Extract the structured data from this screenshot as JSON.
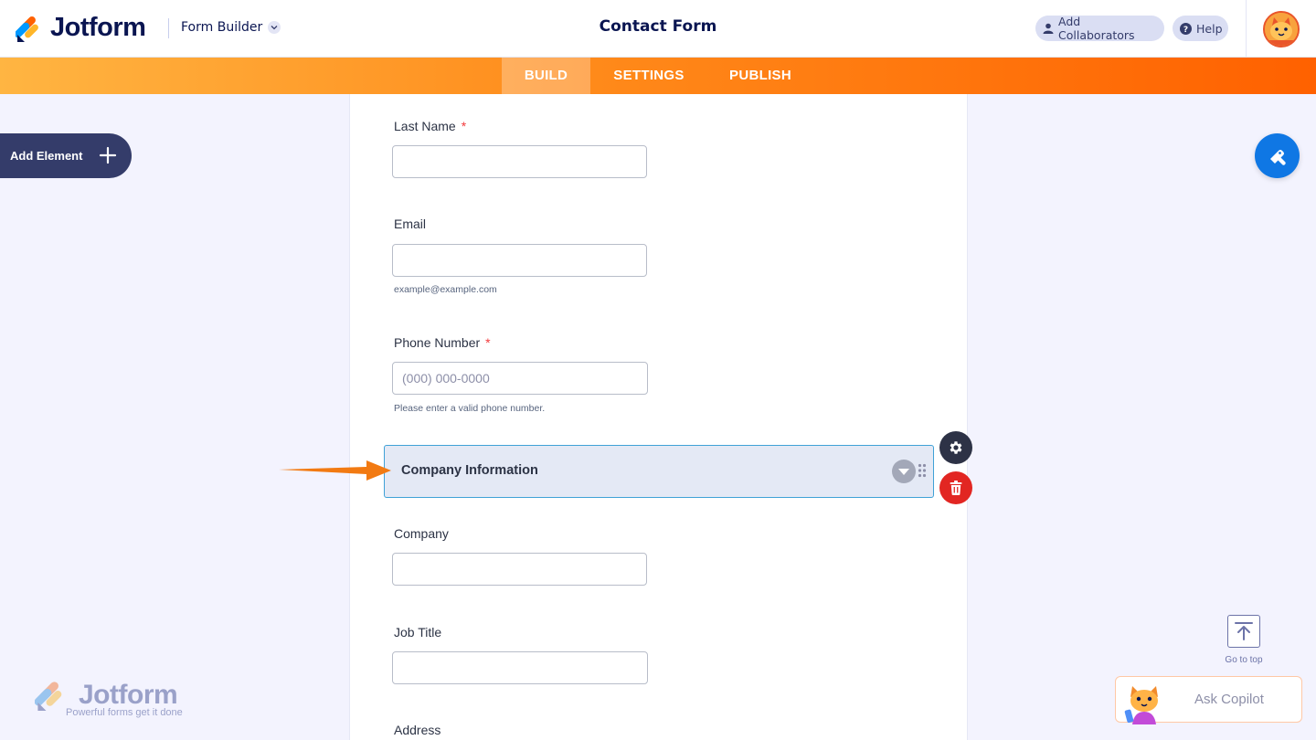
{
  "header": {
    "brand": "Jotform",
    "builder_menu": "Form Builder",
    "form_title": "Contact Form",
    "add_collaborators": "Add Collaborators",
    "help": "Help"
  },
  "nav": {
    "tabs": [
      {
        "label": "BUILD",
        "active": true
      },
      {
        "label": "SETTINGS",
        "active": false
      },
      {
        "label": "PUBLISH",
        "active": false
      }
    ]
  },
  "left_panel": {
    "add_element": "Add Element"
  },
  "form": {
    "fields": {
      "last_name": {
        "label": "Last Name",
        "required": "*",
        "value": ""
      },
      "email": {
        "label": "Email",
        "value": "",
        "sublabel": "example@example.com"
      },
      "phone": {
        "label": "Phone Number",
        "required": "*",
        "placeholder": "(000) 000-0000",
        "sublabel": "Please enter a valid phone number."
      },
      "company": {
        "label": "Company",
        "value": ""
      },
      "job_title": {
        "label": "Job Title",
        "value": ""
      },
      "address": {
        "label": "Address"
      }
    },
    "section": {
      "title": "Company Information",
      "selected": true
    }
  },
  "right_panel": {
    "go_to_top": "Go to top",
    "ask_copilot": "Ask Copilot"
  },
  "watermark": {
    "brand": "Jotform",
    "tagline": "Powerful forms get it done"
  },
  "colors": {
    "accent_orange": "#ff6100",
    "brand_navy": "#0a1551",
    "selection_blue": "#3fa2d7",
    "delete_red": "#e22622",
    "designer_blue": "#0f77e4"
  }
}
